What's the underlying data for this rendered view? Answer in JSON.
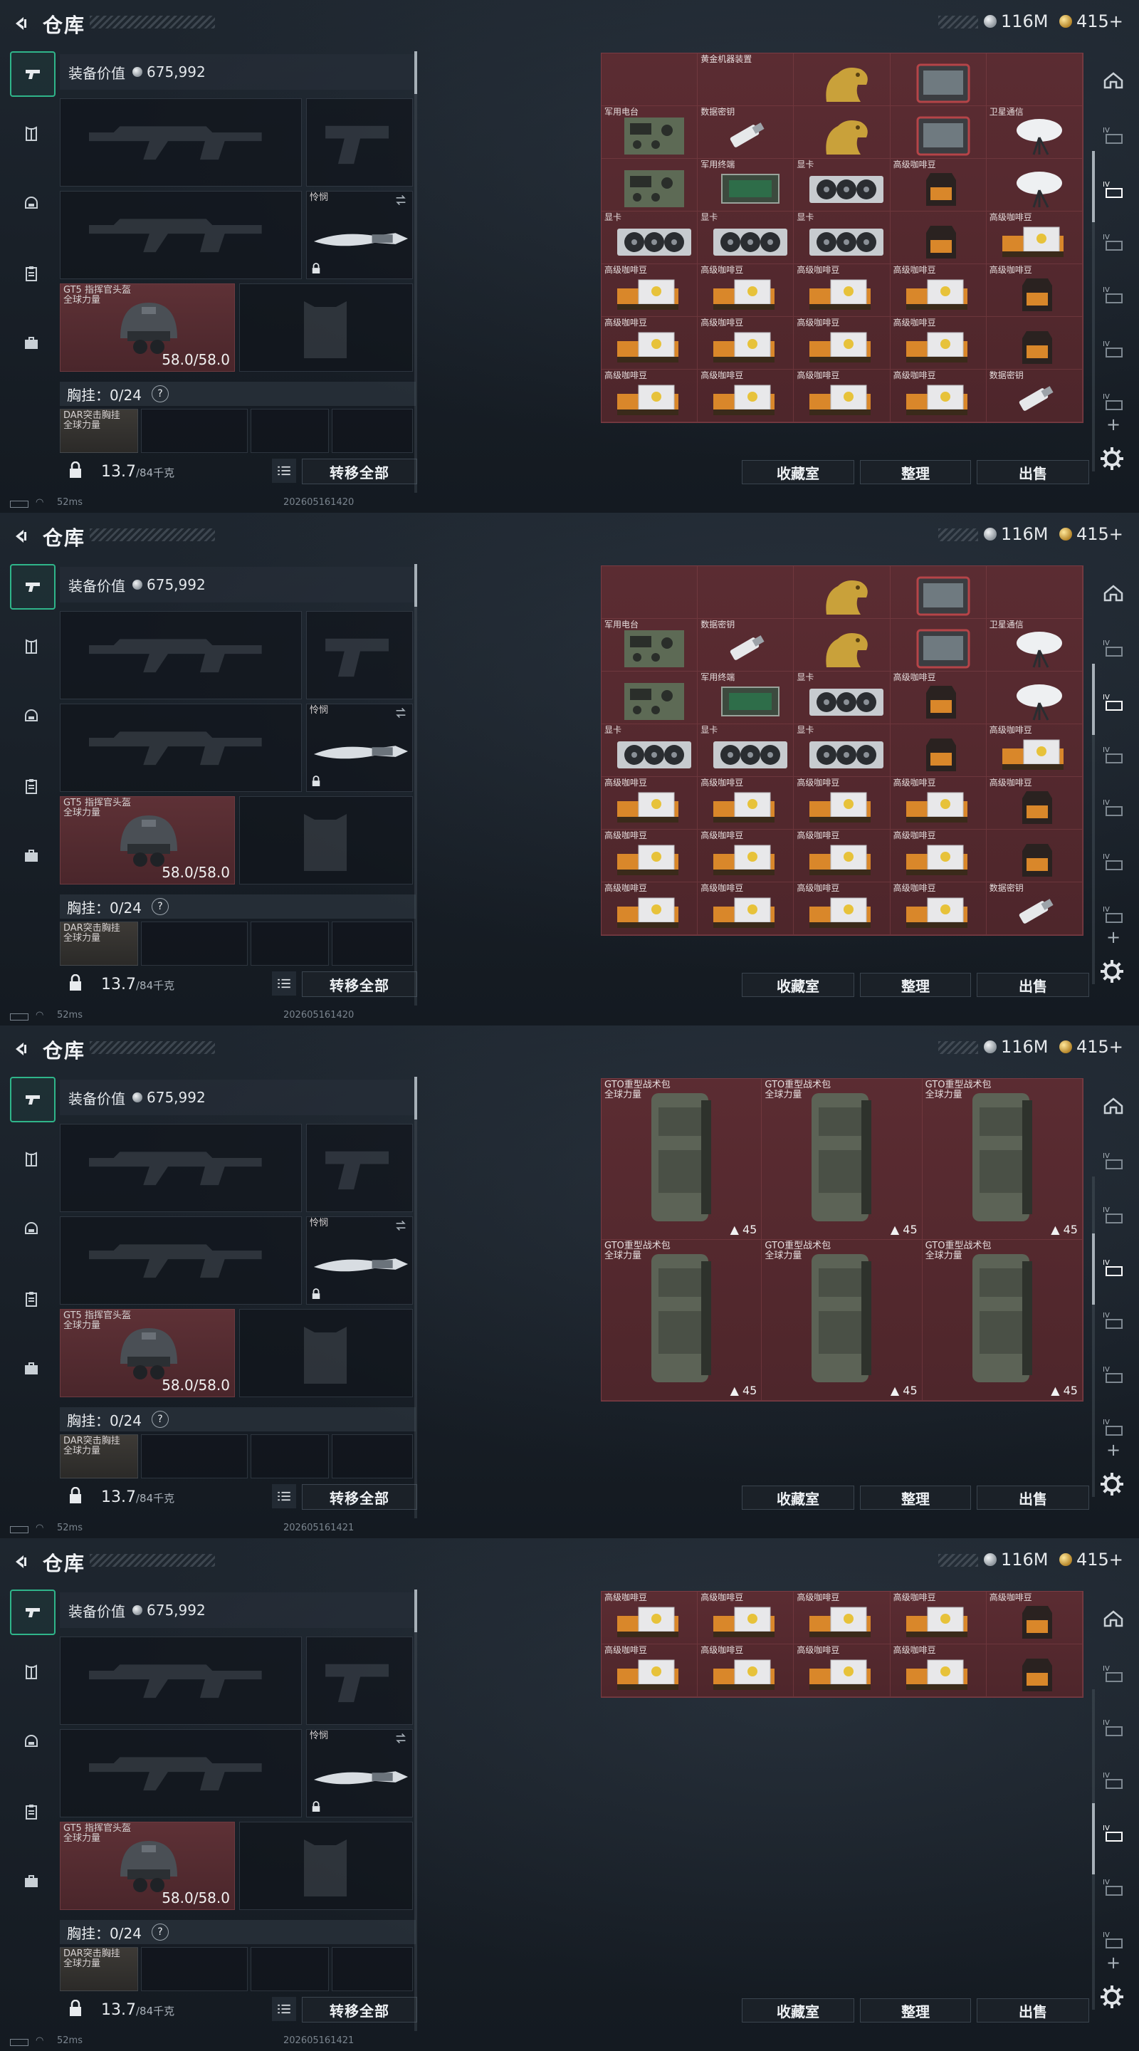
{
  "header": {
    "title": "仓库",
    "silver": "116M",
    "gold": "415+"
  },
  "loadout": {
    "equip_value_label": "装备价值",
    "equip_value": "675,992",
    "melee_label": "怜悯",
    "helmet_name": "GT5 指挥官头盔",
    "helmet_faction": "全球力量",
    "helmet_durability": "58.0/58.0",
    "chest_label": "胸挂：",
    "chest_count": "0/24",
    "chest_q": "?",
    "chest_item_name": "DAR突击胸挂",
    "chest_item_faction": "全球力量",
    "weight": "13.7",
    "weight_cap": "/84千克",
    "transfer_all": "转移全部"
  },
  "buttons": {
    "collection": "收藏室",
    "organize": "整理",
    "sell": "出售"
  },
  "status": {
    "ping": "52ms"
  },
  "frames": [
    {
      "timestamp": "202605161420",
      "cells": [
        {
          "name": "",
          "icon": "blank"
        },
        {
          "name": "黄金机器装置",
          "icon": "blank"
        },
        {
          "name": "",
          "icon": "horse"
        },
        {
          "name": "",
          "icon": "tablet"
        },
        {
          "name": "",
          "icon": "blank"
        },
        {
          "name": "军用电台",
          "icon": "radio"
        },
        {
          "name": "数据密钥",
          "icon": "usb"
        },
        {
          "name": "",
          "icon": "horse"
        },
        {
          "name": "",
          "icon": "tablet"
        },
        {
          "name": "卫星通信",
          "icon": "dish"
        },
        {
          "name": "",
          "icon": "radio"
        },
        {
          "name": "军用终端",
          "icon": "board"
        },
        {
          "name": "显卡",
          "icon": "gpu"
        },
        {
          "name": "高级咖啡豆",
          "icon": "bag"
        },
        {
          "name": "",
          "icon": "dish"
        },
        {
          "name": "显卡",
          "icon": "gpu"
        },
        {
          "name": "显卡",
          "icon": "gpu"
        },
        {
          "name": "显卡",
          "icon": "gpu"
        },
        {
          "name": "",
          "icon": "bag"
        },
        {
          "name": "高级咖啡豆",
          "icon": "coffee"
        },
        {
          "name": "高级咖啡豆",
          "icon": "coffee"
        },
        {
          "name": "高级咖啡豆",
          "icon": "coffee"
        },
        {
          "name": "高级咖啡豆",
          "icon": "coffee"
        },
        {
          "name": "高级咖啡豆",
          "icon": "coffee"
        },
        {
          "name": "高级咖啡豆",
          "icon": "bag"
        },
        {
          "name": "高级咖啡豆",
          "icon": "coffee"
        },
        {
          "name": "高级咖啡豆",
          "icon": "coffee"
        },
        {
          "name": "高级咖啡豆",
          "icon": "coffee"
        },
        {
          "name": "高级咖啡豆",
          "icon": "coffee"
        },
        {
          "name": "",
          "icon": "bag"
        },
        {
          "name": "高级咖啡豆",
          "icon": "coffee"
        },
        {
          "name": "高级咖啡豆",
          "icon": "coffee"
        },
        {
          "name": "高级咖啡豆",
          "icon": "coffee"
        },
        {
          "name": "高级咖啡豆",
          "icon": "coffee"
        },
        {
          "name": "数据密钥",
          "icon": "usb"
        }
      ]
    },
    {
      "timestamp": "202605161420",
      "cells": [
        {
          "name": "",
          "icon": "blank"
        },
        {
          "name": "",
          "icon": "blank"
        },
        {
          "name": "",
          "icon": "horse"
        },
        {
          "name": "",
          "icon": "tablet"
        },
        {
          "name": "",
          "icon": "blank"
        },
        {
          "name": "军用电台",
          "icon": "radio"
        },
        {
          "name": "数据密钥",
          "icon": "usb"
        },
        {
          "name": "",
          "icon": "horse"
        },
        {
          "name": "",
          "icon": "tablet"
        },
        {
          "name": "卫星通信",
          "icon": "dish"
        },
        {
          "name": "",
          "icon": "radio"
        },
        {
          "name": "军用终端",
          "icon": "board"
        },
        {
          "name": "显卡",
          "icon": "gpu"
        },
        {
          "name": "高级咖啡豆",
          "icon": "bag"
        },
        {
          "name": "",
          "icon": "dish"
        },
        {
          "name": "显卡",
          "icon": "gpu"
        },
        {
          "name": "显卡",
          "icon": "gpu"
        },
        {
          "name": "显卡",
          "icon": "gpu"
        },
        {
          "name": "",
          "icon": "bag"
        },
        {
          "name": "高级咖啡豆",
          "icon": "coffee"
        },
        {
          "name": "高级咖啡豆",
          "icon": "coffee"
        },
        {
          "name": "高级咖啡豆",
          "icon": "coffee"
        },
        {
          "name": "高级咖啡豆",
          "icon": "coffee"
        },
        {
          "name": "高级咖啡豆",
          "icon": "coffee"
        },
        {
          "name": "高级咖啡豆",
          "icon": "bag"
        },
        {
          "name": "高级咖啡豆",
          "icon": "coffee"
        },
        {
          "name": "高级咖啡豆",
          "icon": "coffee"
        },
        {
          "name": "高级咖啡豆",
          "icon": "coffee"
        },
        {
          "name": "高级咖啡豆",
          "icon": "coffee"
        },
        {
          "name": "",
          "icon": "bag"
        },
        {
          "name": "高级咖啡豆",
          "icon": "coffee"
        },
        {
          "name": "高级咖啡豆",
          "icon": "coffee"
        },
        {
          "name": "高级咖啡豆",
          "icon": "coffee"
        },
        {
          "name": "高级咖啡豆",
          "icon": "coffee"
        },
        {
          "name": "数据密钥",
          "icon": "usb"
        }
      ]
    },
    {
      "timestamp": "202605161421",
      "backpacks": [
        {
          "name": "GTO重型战术包",
          "faction": "全球力量",
          "count": "45"
        },
        {
          "name": "GTO重型战术包",
          "faction": "全球力量",
          "count": "45"
        },
        {
          "name": "GTO重型战术包",
          "faction": "全球力量",
          "count": "45"
        },
        {
          "name": "GTO重型战术包",
          "faction": "全球力量",
          "count": "45"
        },
        {
          "name": "GTO重型战术包",
          "faction": "全球力量",
          "count": "45"
        },
        {
          "name": "GTO重型战术包",
          "faction": "全球力量",
          "count": "45"
        }
      ]
    },
    {
      "timestamp": "202605161421",
      "cells": [
        {
          "name": "高级咖啡豆",
          "icon": "coffee"
        },
        {
          "name": "高级咖啡豆",
          "icon": "coffee"
        },
        {
          "name": "高级咖啡豆",
          "icon": "coffee"
        },
        {
          "name": "高级咖啡豆",
          "icon": "coffee"
        },
        {
          "name": "高级咖啡豆",
          "icon": "bag"
        },
        {
          "name": "高级咖啡豆",
          "icon": "coffee"
        },
        {
          "name": "高级咖啡豆",
          "icon": "coffee"
        },
        {
          "name": "高级咖啡豆",
          "icon": "coffee"
        },
        {
          "name": "高级咖啡豆",
          "icon": "coffee"
        },
        {
          "name": "",
          "icon": "bag"
        }
      ]
    }
  ]
}
